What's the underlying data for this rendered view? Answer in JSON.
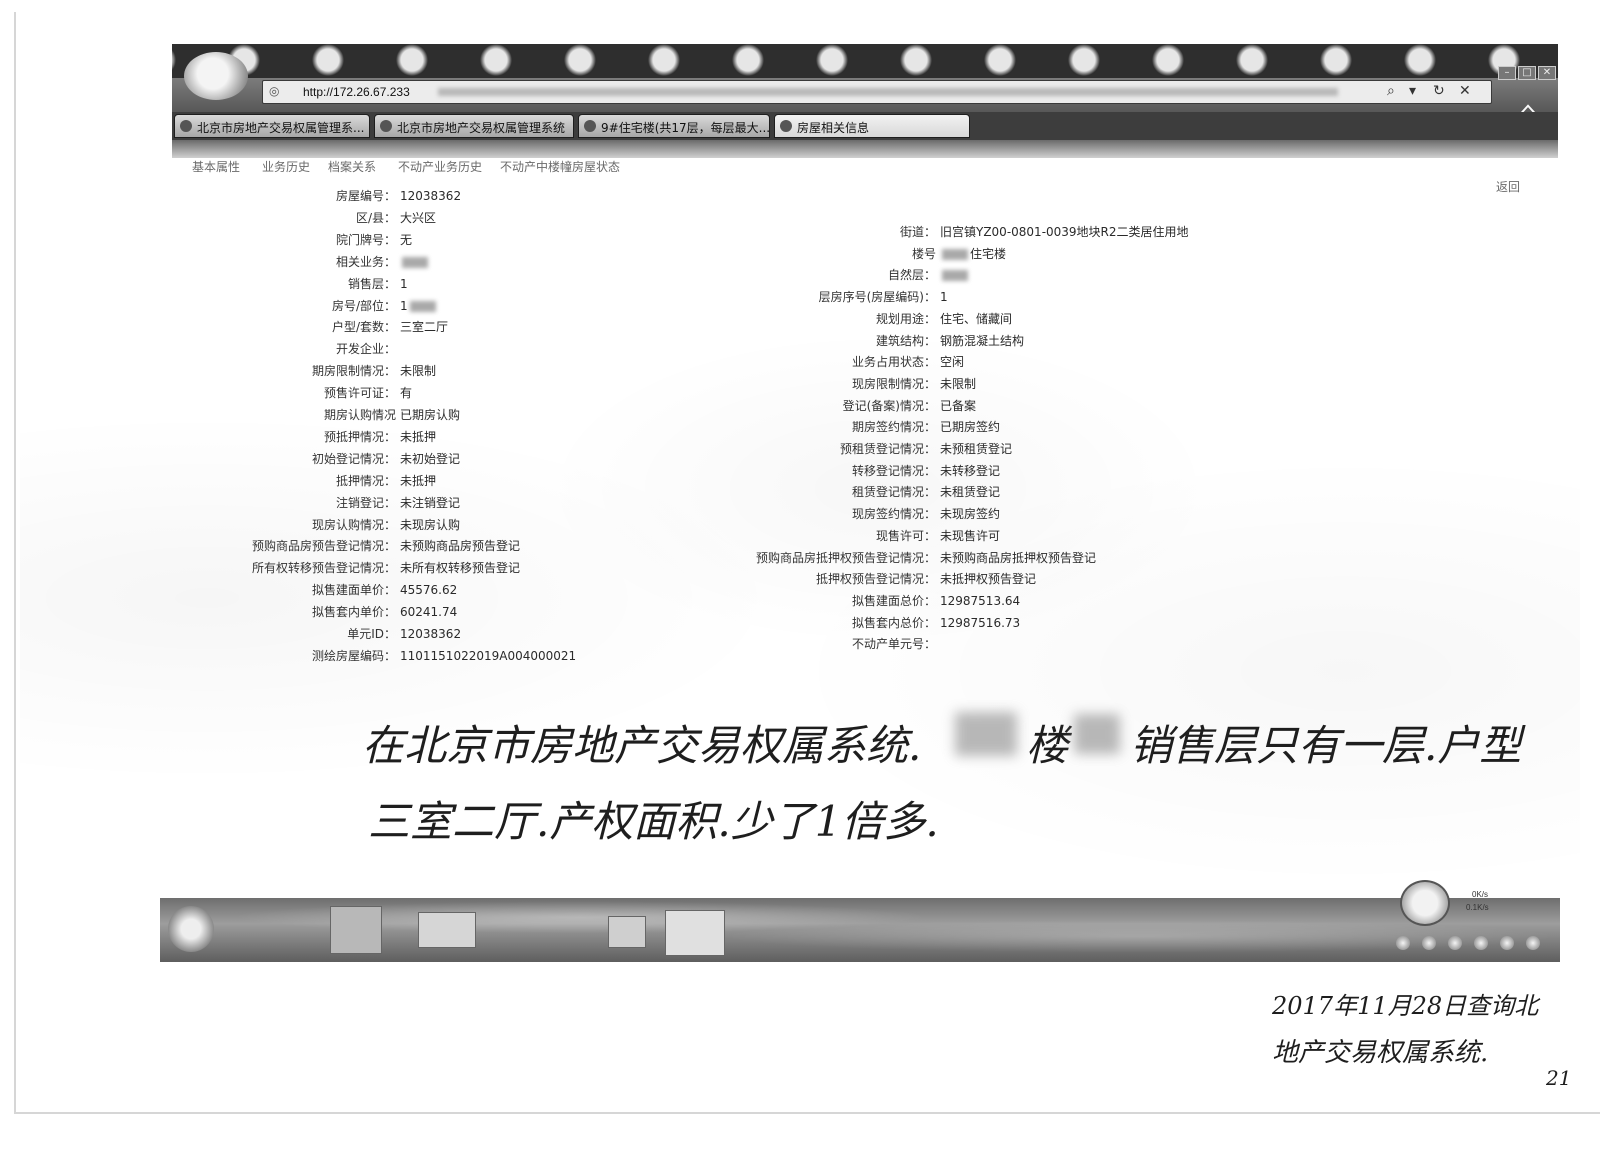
{
  "browser": {
    "address": "http://172.26.67.233",
    "tabs": [
      {
        "label": "北京市房地产交易权属管理系..."
      },
      {
        "label": "北京市房地产交易权属管理系统"
      },
      {
        "label": "9#住宅楼(共17层，每层最大..."
      },
      {
        "label": "房屋相关信息"
      }
    ],
    "active_tab": 3,
    "icons": [
      "back-icon",
      "site-icon",
      "search-icon",
      "dropdown-icon",
      "refresh-icon",
      "close-icon",
      "home-icon"
    ],
    "icon_glyphs": {
      "site": "◎",
      "search": "⌕",
      "dropdown": "▾",
      "refresh": "↻",
      "close": "✕",
      "home": "⌂",
      "minimize": "–",
      "maximize": "□",
      "window_close": "✕"
    }
  },
  "page": {
    "nav": [
      "基本属性",
      "业务历史",
      "档案关系",
      "不动产业务历史",
      "不动产中楼幢房屋状态"
    ],
    "back_label": "返回",
    "left_fields": [
      {
        "label": "房屋编号：",
        "value": "12038362"
      },
      {
        "label": "区/县：",
        "value": "大兴区"
      },
      {
        "label": "院门牌号：",
        "value": "无"
      },
      {
        "label": "相关业务：",
        "value": "",
        "redacted": "full"
      },
      {
        "label": "销售层：",
        "value": "1"
      },
      {
        "label": "房号/部位：",
        "value": "1",
        "redacted": "suffix"
      },
      {
        "label": "户型/套数：",
        "value": "三室二厅"
      },
      {
        "label": "开发企业：",
        "value": ""
      },
      {
        "label": "期房限制情况：",
        "value": "未限制"
      },
      {
        "label": "预售许可证：",
        "value": "有"
      },
      {
        "label": "期房认购情况",
        "value": "已期房认购"
      },
      {
        "label": "预抵押情况：",
        "value": "未抵押"
      },
      {
        "label": "初始登记情况：",
        "value": "未初始登记"
      },
      {
        "label": "抵押情况：",
        "value": "未抵押"
      },
      {
        "label": "注销登记：",
        "value": "未注销登记"
      },
      {
        "label": "现房认购情况：",
        "value": "未现房认购"
      },
      {
        "label": "预购商品房预告登记情况：",
        "value": "未预购商品房预告登记"
      },
      {
        "label": "所有权转移预告登记情况：",
        "value": "未所有权转移预告登记"
      },
      {
        "label": "拟售建面单价：",
        "value": "45576.62"
      },
      {
        "label": "拟售套内单价：",
        "value": "60241.74"
      },
      {
        "label": "单元ID：",
        "value": "12038362"
      },
      {
        "label": "测绘房屋编码：",
        "value": "1101151022019A004000021"
      }
    ],
    "right_fields": [
      {
        "label": "街道：",
        "value": "旧宫镇YZ00-0801-0039地块R2二类居住用地"
      },
      {
        "label": "楼号",
        "value": "住宅楼",
        "redacted": "prefix"
      },
      {
        "label": "自然层：",
        "value": "",
        "redacted": "full"
      },
      {
        "label": "层房序号(房屋编码)：",
        "value": "1"
      },
      {
        "label": "规划用途：",
        "value": "住宅、储藏间"
      },
      {
        "label": "建筑结构：",
        "value": "钢筋混凝土结构"
      },
      {
        "label": "业务占用状态：",
        "value": "空闲"
      },
      {
        "label": "现房限制情况：",
        "value": "未限制"
      },
      {
        "label": "登记(备案)情况：",
        "value": "已备案"
      },
      {
        "label": "期房签约情况：",
        "value": "已期房签约"
      },
      {
        "label": "预租赁登记情况：",
        "value": "未预租赁登记"
      },
      {
        "label": "转移登记情况：",
        "value": "未转移登记"
      },
      {
        "label": "租赁登记情况：",
        "value": "未租赁登记"
      },
      {
        "label": "现房签约情况：",
        "value": "未现房签约"
      },
      {
        "label": "现售许可：",
        "value": "未现售许可"
      },
      {
        "label": "预购商品房抵押权预告登记情况：",
        "value": "未预购商品房抵押权预告登记"
      },
      {
        "label": "抵押权预告登记情况：",
        "value": "未抵押权预告登记"
      },
      {
        "label": "拟售建面总价：",
        "value": "12987513.64"
      },
      {
        "label": "拟售套内总价：",
        "value": "12987516.73"
      },
      {
        "label": "不动产单元号：",
        "value": ""
      }
    ]
  },
  "handwriting": {
    "note_part1": "在北京市房地产交易权属系统.",
    "note_building": "楼",
    "note_part2": "销售层只有一层.户型",
    "note_line2": "三室二厅.产权面积.少了1倍多.",
    "date_line1": "2017年11月28日查询北",
    "date_line2": "地产交易权属系统.",
    "corner_fragment": "21"
  },
  "taskbar": {
    "net_up": "0K/s",
    "net_down": "0.1K/s"
  },
  "colors": {
    "chrome_dark": "#2e2e2e",
    "ink": "#1e1e1e",
    "field_text": "#2a2a2a",
    "nav_text": "#6a6a6a"
  }
}
